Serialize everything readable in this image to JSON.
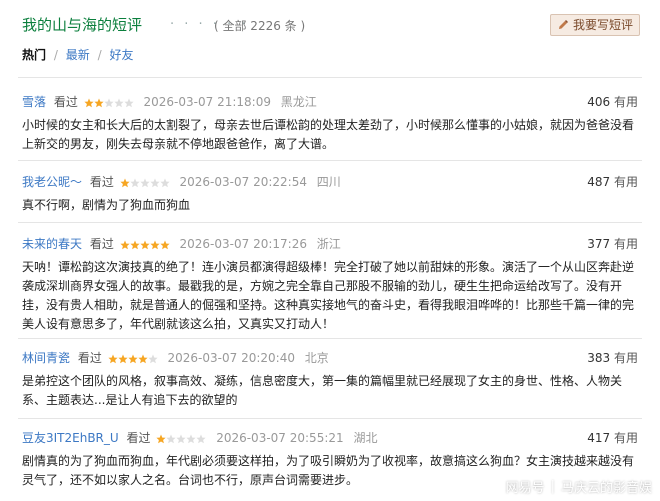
{
  "header": {
    "title": "我的山与海的短评",
    "dots": "· · · · · ·",
    "total": "( 全部 2226 条 )",
    "write_button": "我要写短评"
  },
  "tabs": [
    {
      "label": "热门",
      "active": true
    },
    {
      "label": "最新",
      "active": false
    },
    {
      "label": "好友",
      "active": false
    }
  ],
  "tab_separator": "/",
  "comments": [
    {
      "user": "雪落",
      "seen": "看过",
      "rating": 2,
      "time": "2026-03-07 21:18:09",
      "location": "黑龙江",
      "useful_count": "406",
      "useful_label": "有用",
      "content": "小时候的女主和长大后的太割裂了，母亲去世后谭松韵的处理太差劲了，小时候那么懂事的小姑娘，就因为爸爸没看上新交的男友，刚失去母亲就不停地跟爸爸作，离了大谱。"
    },
    {
      "user": "我老公昵～",
      "seen": "看过",
      "rating": 1,
      "time": "2026-03-07 20:22:54",
      "location": "四川",
      "useful_count": "487",
      "useful_label": "有用",
      "content": "真不行啊，剧情为了狗血而狗血"
    },
    {
      "user": "未来的春天",
      "seen": "看过",
      "rating": 5,
      "time": "2026-03-07 20:17:26",
      "location": "浙江",
      "useful_count": "377",
      "useful_label": "有用",
      "content": "天呐！谭松韵这次演技真的绝了！连小演员都演得超级棒！完全打破了她以前甜妹的形象。演活了一个从山区奔赴逆袭成深圳商界女强人的故事。最戳我的是，方婉之完全靠自己那股不服输的劲儿，硬生生把命运给改写了。没有开挂，没有贵人相助，就是普通人的倔强和坚持。这种真实接地气的奋斗史，看得我眼泪哗哗的！比那些千篇一律的完美人设有意思多了，年代剧就该这么拍，又真实又打动人！"
    },
    {
      "user": "林间青瓷",
      "seen": "看过",
      "rating": 4,
      "time": "2026-03-07 20:20:40",
      "location": "北京",
      "useful_count": "383",
      "useful_label": "有用",
      "content": "是弟控这个团队的风格，叙事高效、凝练，信息密度大，第一集的篇幅里就已经展现了女主的身世、性格、人物关系、主题表达...是让人有追下去的欲望的"
    },
    {
      "user": "豆友3IT2EhBR_U",
      "seen": "看过",
      "rating": 1,
      "time": "2026-03-07 20:55:21",
      "location": "湖北",
      "useful_count": "417",
      "useful_label": "有用",
      "content": "剧情真的为了狗血而狗血，年代剧必须要这样拍，为了吸引瞬奶为了收视率，故意搞这么狗血？女主演技越来越没有灵气了，还不如以家人之名。台词也不行，原声台词需要进步。"
    }
  ],
  "watermark": {
    "site": "网易号",
    "separator": "|",
    "author": "马庆云的影音娱"
  },
  "colors": {
    "title_green": "#0b7f3d",
    "link_blue": "#3c78c4",
    "star_on": "#f6a623",
    "star_off": "#dddddd",
    "button_bg": "#f6ebe2"
  }
}
